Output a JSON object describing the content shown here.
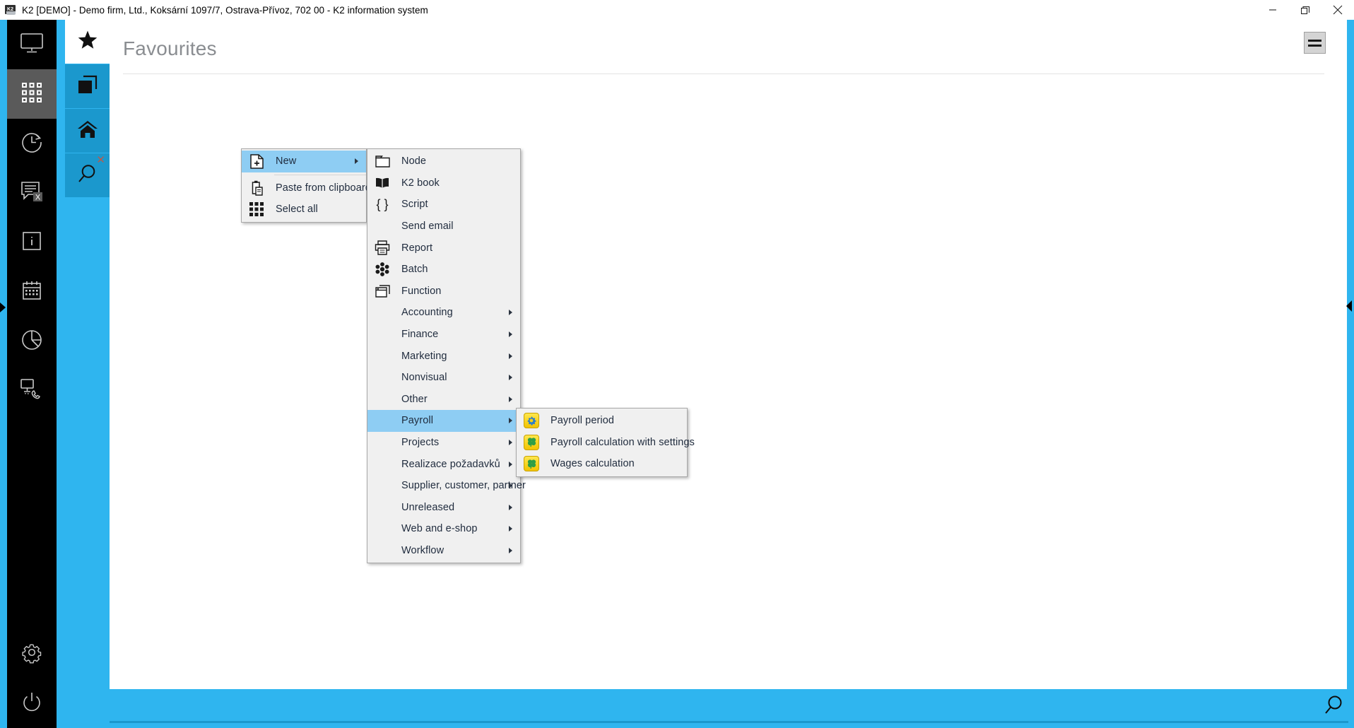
{
  "window": {
    "title": "K2 [DEMO] - Demo firm, Ltd., Koksární 1097/7, Ostrava-Přívoz, 702 00 - K2 information system",
    "app_icon": "k2-app-icon",
    "controls": [
      {
        "name": "minimize-button",
        "icon": "minimize-icon"
      },
      {
        "name": "maximize-button",
        "icon": "restore-icon"
      },
      {
        "name": "close-button",
        "icon": "close-icon"
      }
    ]
  },
  "colors": {
    "accent_blue": "#2fb5ef",
    "tab_blue": "#1b98cd",
    "rail_black": "#000000",
    "rail_selected": "#5a5a5a",
    "menu_bg": "#f0f0f0",
    "menu_highlight": "#8ecdf3",
    "title_grey": "#8a8d91"
  },
  "rail": {
    "items": [
      {
        "label": "Desktop",
        "icon": "monitor-icon",
        "selected": false
      },
      {
        "label": "Modules",
        "icon": "grid-apps-icon",
        "selected": true
      },
      {
        "label": "History",
        "icon": "clock-back-icon",
        "selected": false
      },
      {
        "label": "Messages",
        "icon": "message-x-icon",
        "selected": false
      },
      {
        "label": "Information",
        "icon": "info-icon",
        "selected": false
      },
      {
        "label": "Calendar",
        "icon": "calendar-icon",
        "selected": false
      },
      {
        "label": "Reports",
        "icon": "pie-chart-icon",
        "selected": false
      },
      {
        "label": "Remote support",
        "icon": "monitor-phone-icon",
        "selected": false
      }
    ],
    "bottom_items": [
      {
        "label": "Settings",
        "icon": "gear-icon"
      },
      {
        "label": "Power",
        "icon": "power-icon"
      }
    ],
    "expander": "expand-rail-arrow-icon"
  },
  "tabs": [
    {
      "label": "Favourites",
      "icon": "star-icon",
      "active": true,
      "closable": false
    },
    {
      "label": "Windows",
      "icon": "windows-stack-icon",
      "active": false,
      "closable": false
    },
    {
      "label": "Home",
      "icon": "home-icon",
      "active": false,
      "closable": false
    },
    {
      "label": "Search",
      "icon": "magnifier-icon",
      "active": false,
      "closable": true,
      "close_icon": "close-x-icon"
    }
  ],
  "page": {
    "title": "Favourites",
    "menu_button": {
      "name": "hamburger-menu-button",
      "icon": "hamburger-icon"
    }
  },
  "status_bar": {
    "search_icon": "magnifier-icon"
  },
  "context_menu": {
    "items": [
      {
        "label": "New",
        "icon": "new-document-icon",
        "submenu": true,
        "selected": true,
        "separator_after": true
      },
      {
        "label": "Paste from clipboard",
        "icon": "clipboard-paste-icon",
        "submenu": false,
        "selected": false
      },
      {
        "label": "Select all",
        "icon": "select-all-grid-icon",
        "submenu": false,
        "selected": false
      }
    ]
  },
  "new_submenu": {
    "items": [
      {
        "label": "Node",
        "icon": "folder-icon",
        "submenu": false,
        "selected": false
      },
      {
        "label": "K2 book",
        "icon": "book-icon",
        "submenu": false,
        "selected": false
      },
      {
        "label": "Script",
        "icon": "braces-icon",
        "submenu": false,
        "selected": false
      },
      {
        "label": "Send email",
        "icon": "none",
        "submenu": false,
        "selected": false
      },
      {
        "label": "Report",
        "icon": "printer-icon",
        "submenu": false,
        "selected": false
      },
      {
        "label": "Batch",
        "icon": "batch-dots-icon",
        "submenu": false,
        "selected": false
      },
      {
        "label": "Function",
        "icon": "window-stack-icon",
        "submenu": false,
        "selected": false
      },
      {
        "label": "Accounting",
        "icon": "none",
        "submenu": true,
        "selected": false
      },
      {
        "label": "Finance",
        "icon": "none",
        "submenu": true,
        "selected": false
      },
      {
        "label": "Marketing",
        "icon": "none",
        "submenu": true,
        "selected": false
      },
      {
        "label": "Nonvisual",
        "icon": "none",
        "submenu": true,
        "selected": false
      },
      {
        "label": "Other",
        "icon": "none",
        "submenu": true,
        "selected": false
      },
      {
        "label": "Payroll",
        "icon": "none",
        "submenu": true,
        "selected": true
      },
      {
        "label": "Projects",
        "icon": "none",
        "submenu": true,
        "selected": false
      },
      {
        "label": "Realizace požadavků",
        "icon": "none",
        "submenu": true,
        "selected": false
      },
      {
        "label": "Supplier, customer, partner",
        "icon": "none",
        "submenu": true,
        "selected": false
      },
      {
        "label": "Unreleased",
        "icon": "none",
        "submenu": true,
        "selected": false
      },
      {
        "label": "Web and e-shop",
        "icon": "none",
        "submenu": true,
        "selected": false
      },
      {
        "label": "Workflow",
        "icon": "none",
        "submenu": true,
        "selected": false
      }
    ]
  },
  "payroll_submenu": {
    "items": [
      {
        "label": "Payroll period",
        "icon": "yellow-gear-icon",
        "submenu": false,
        "selected": false
      },
      {
        "label": "Payroll calculation with settings",
        "icon": "yellow-clover-icon",
        "submenu": false,
        "selected": false
      },
      {
        "label": "Wages calculation",
        "icon": "yellow-clover-icon",
        "submenu": false,
        "selected": false
      }
    ]
  }
}
